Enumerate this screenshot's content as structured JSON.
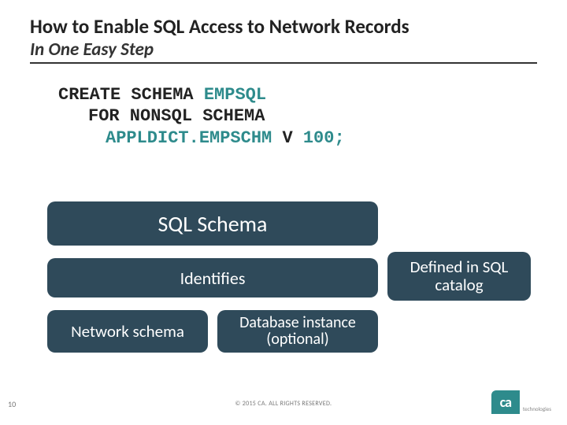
{
  "title": "How to Enable SQL Access to Network Records",
  "subtitle": "In One Easy Step",
  "code": {
    "l1_kw": "CREATE SCHEMA",
    "l1_id": "EMPSQL",
    "l2_kw1": "FOR NONSQL SCHEMA",
    "l3_id": "APPLDICT.EMPSCHM",
    "l3_kw": "V",
    "l3_val": "100;"
  },
  "boxes": {
    "sql": "SQL Schema",
    "identifies": "Identifies",
    "defined": "Defined in SQL catalog",
    "network": "Network schema",
    "db": "Database instance (optional)"
  },
  "pageNum": "10",
  "copyright": "© 2015 CA. ALL RIGHTS RESERVED.",
  "logo": {
    "text": "ca",
    "tag": "technologies"
  }
}
